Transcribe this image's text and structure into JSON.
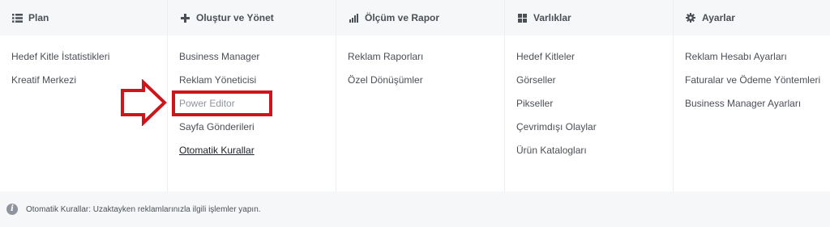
{
  "columns": [
    {
      "header": "Plan",
      "icon": "list-icon",
      "items": [
        "Hedef Kitle İstatistikleri",
        "Kreatif Merkezi"
      ]
    },
    {
      "header": "Oluştur ve Yönet",
      "icon": "plus-icon",
      "items": [
        "Business Manager",
        "Reklam Yöneticisi",
        "Power Editor",
        "Sayfa Gönderileri",
        "Otomatik Kurallar"
      ]
    },
    {
      "header": "Ölçüm ve Rapor",
      "icon": "bar-chart-icon",
      "items": [
        "Reklam Raporları",
        "Özel Dönüşümler"
      ]
    },
    {
      "header": "Varlıklar",
      "icon": "grid-icon",
      "items": [
        "Hedef Kitleler",
        "Görseller",
        "Pikseller",
        "Çevrimdışı Olaylar",
        "Ürün Katalogları"
      ]
    },
    {
      "header": "Ayarlar",
      "icon": "gear-icon",
      "items": [
        "Reklam Hesabı Ayarları",
        "Faturalar ve Ödeme Yöntemleri",
        "Business Manager Ayarları"
      ]
    }
  ],
  "footer": {
    "icon": "info-icon",
    "text": "Otomatik Kurallar: Uzaktayken reklamlarınızla ilgili işlemler yapın."
  },
  "annotation": {
    "highlight_color": "#d0141c",
    "arrow": "right-arrow-outline",
    "highlighted_item": "Power Editor"
  }
}
